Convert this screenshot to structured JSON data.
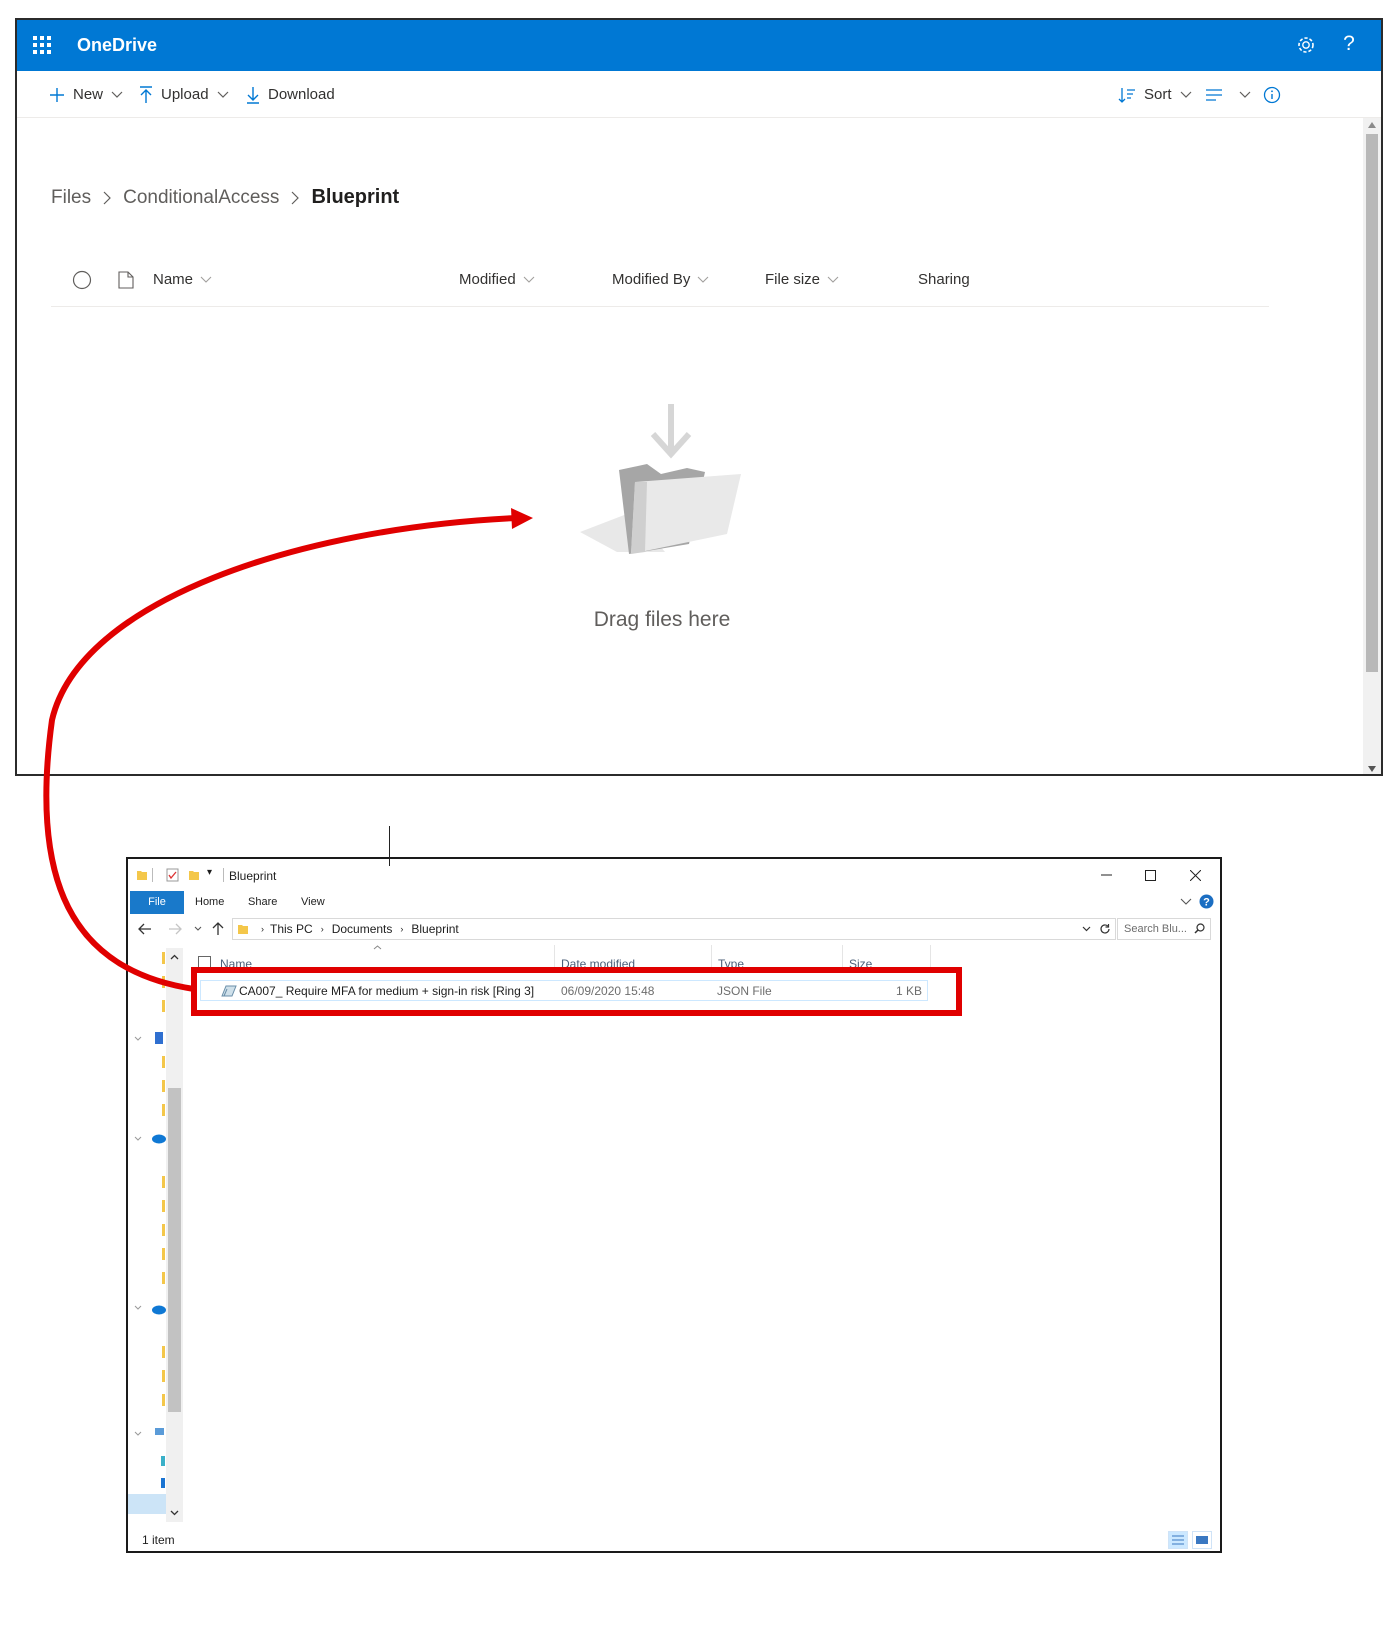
{
  "onedrive": {
    "brand": "OneDrive",
    "commands": {
      "new_label": "New",
      "upload_label": "Upload",
      "download_label": "Download",
      "sort_label": "Sort"
    },
    "breadcrumb": [
      "Files",
      "ConditionalAccess",
      "Blueprint"
    ],
    "columns": {
      "name": "Name",
      "modified": "Modified",
      "modified_by": "Modified By",
      "file_size": "File size",
      "sharing": "Sharing"
    },
    "empty_text": "Drag files here",
    "colors": {
      "suite_bar": "#0078d4"
    }
  },
  "explorer": {
    "title": "Blueprint",
    "ribbon_tabs": [
      "File",
      "Home",
      "Share",
      "View"
    ],
    "address": [
      "This PC",
      "Documents",
      "Blueprint"
    ],
    "search_placeholder": "Search Blu...",
    "columns": {
      "name": "Name",
      "date_modified": "Date modified",
      "type": "Type",
      "size": "Size"
    },
    "file": {
      "name": "CA007_ Require MFA for medium + sign-in risk [Ring 3]",
      "date_modified": "06/09/2020 15:48",
      "type": "JSON File",
      "size": "1 KB"
    },
    "status": "1 item"
  },
  "annotation": {
    "color": "#e00000"
  }
}
